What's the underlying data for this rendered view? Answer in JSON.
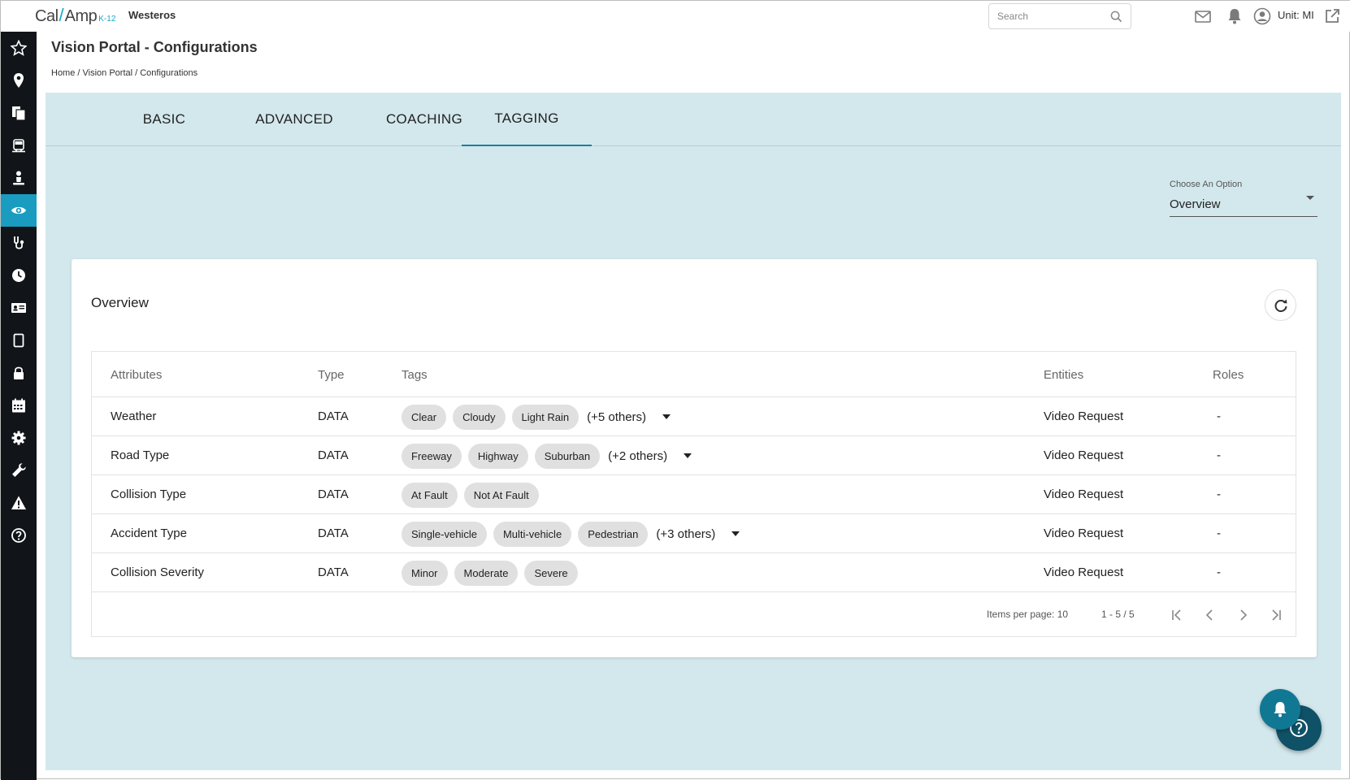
{
  "topbar": {
    "logo": {
      "brand_left": "Cal",
      "brand_right": "Amp",
      "suffix": "K-12"
    },
    "org_name": "Westeros",
    "search": {
      "placeholder": "Search",
      "value": ""
    },
    "unit_label": "Unit: MI",
    "icons": [
      "mail-icon",
      "bell-icon",
      "user-icon",
      "external-link-icon"
    ]
  },
  "sidebar": {
    "items": [
      {
        "name": "star-icon",
        "active": false
      },
      {
        "name": "location-pin-icon",
        "active": false
      },
      {
        "name": "documents-icon",
        "active": false
      },
      {
        "name": "bus-icon",
        "active": false
      },
      {
        "name": "driver-icon",
        "active": false
      },
      {
        "name": "eye-icon",
        "active": true
      },
      {
        "name": "stethoscope-icon",
        "active": false
      },
      {
        "name": "clock-icon",
        "active": false
      },
      {
        "name": "id-card-icon",
        "active": false
      },
      {
        "name": "tablet-icon",
        "active": false
      },
      {
        "name": "lock-icon",
        "active": false
      },
      {
        "name": "calendar-icon",
        "active": false
      },
      {
        "name": "gear-icon",
        "active": false
      },
      {
        "name": "wrench-icon",
        "active": false
      },
      {
        "name": "warning-icon",
        "active": false
      },
      {
        "name": "help-icon",
        "active": false
      }
    ],
    "active_color": "#1a9cc0",
    "background": "#111418"
  },
  "page": {
    "title": "Vision Portal - Configurations",
    "breadcrumb": "Home / Vision Portal / Configurations"
  },
  "tabs": [
    {
      "label": "BASIC",
      "active": false
    },
    {
      "label": "ADVANCED",
      "active": false
    },
    {
      "label": "COACHING",
      "active": false
    },
    {
      "label": "TAGGING",
      "active": true
    }
  ],
  "option_select": {
    "label": "Choose An Option",
    "value": "Overview"
  },
  "overview": {
    "title": "Overview",
    "columns": [
      "Attributes",
      "Type",
      "Tags",
      "Entities",
      "Roles"
    ],
    "rows": [
      {
        "attribute": "Weather",
        "type": "DATA",
        "tags": [
          "Clear",
          "Cloudy",
          "Light Rain"
        ],
        "others": "(+5 others)",
        "entities": "Video Request",
        "roles": "-"
      },
      {
        "attribute": "Road Type",
        "type": "DATA",
        "tags": [
          "Freeway",
          "Highway",
          "Suburban"
        ],
        "others": "(+2 others)",
        "entities": "Video Request",
        "roles": "-"
      },
      {
        "attribute": "Collision Type",
        "type": "DATA",
        "tags": [
          "At Fault",
          "Not At Fault"
        ],
        "others": "",
        "entities": "Video Request",
        "roles": "-"
      },
      {
        "attribute": "Accident Type",
        "type": "DATA",
        "tags": [
          "Single-vehicle",
          "Multi-vehicle",
          "Pedestrian"
        ],
        "others": "(+3 others)",
        "entities": "Video Request",
        "roles": "-"
      },
      {
        "attribute": "Collision Severity",
        "type": "DATA",
        "tags": [
          "Minor",
          "Moderate",
          "Severe"
        ],
        "others": "",
        "entities": "Video Request",
        "roles": "-"
      }
    ],
    "paginator": {
      "items_per_page": "Items per page: 10",
      "range": "1 - 5 / 5"
    }
  },
  "colors": {
    "panel_bg": "#d3e8ed",
    "accent": "#1a7fa0",
    "chip_bg": "#e0e0e0",
    "fab_bell": "#117894",
    "fab_help": "#0f5166"
  }
}
